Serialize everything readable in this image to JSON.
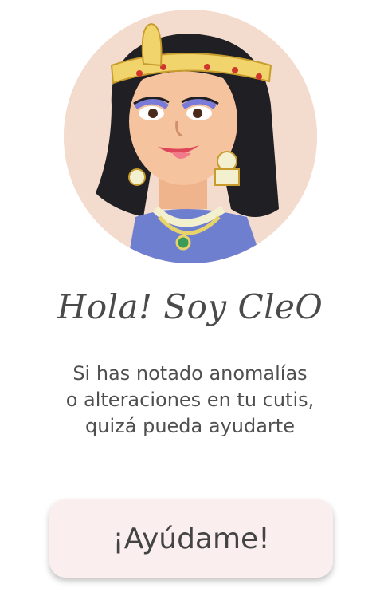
{
  "avatar": {
    "description_icon": "cleopatra-avatar-icon"
  },
  "greeting": {
    "title": "Hola! Soy CleO"
  },
  "intro": {
    "line1": "Si has notado anomalías",
    "line2": "o alteraciones en tu cutis,",
    "line3": "quizá pueda ayudarte"
  },
  "actions": {
    "help_label": "¡Ayúdame!"
  },
  "colors": {
    "button_bg": "#fbeeee",
    "text": "#4f4f4f",
    "avatar_bg": "#f3dccd"
  }
}
